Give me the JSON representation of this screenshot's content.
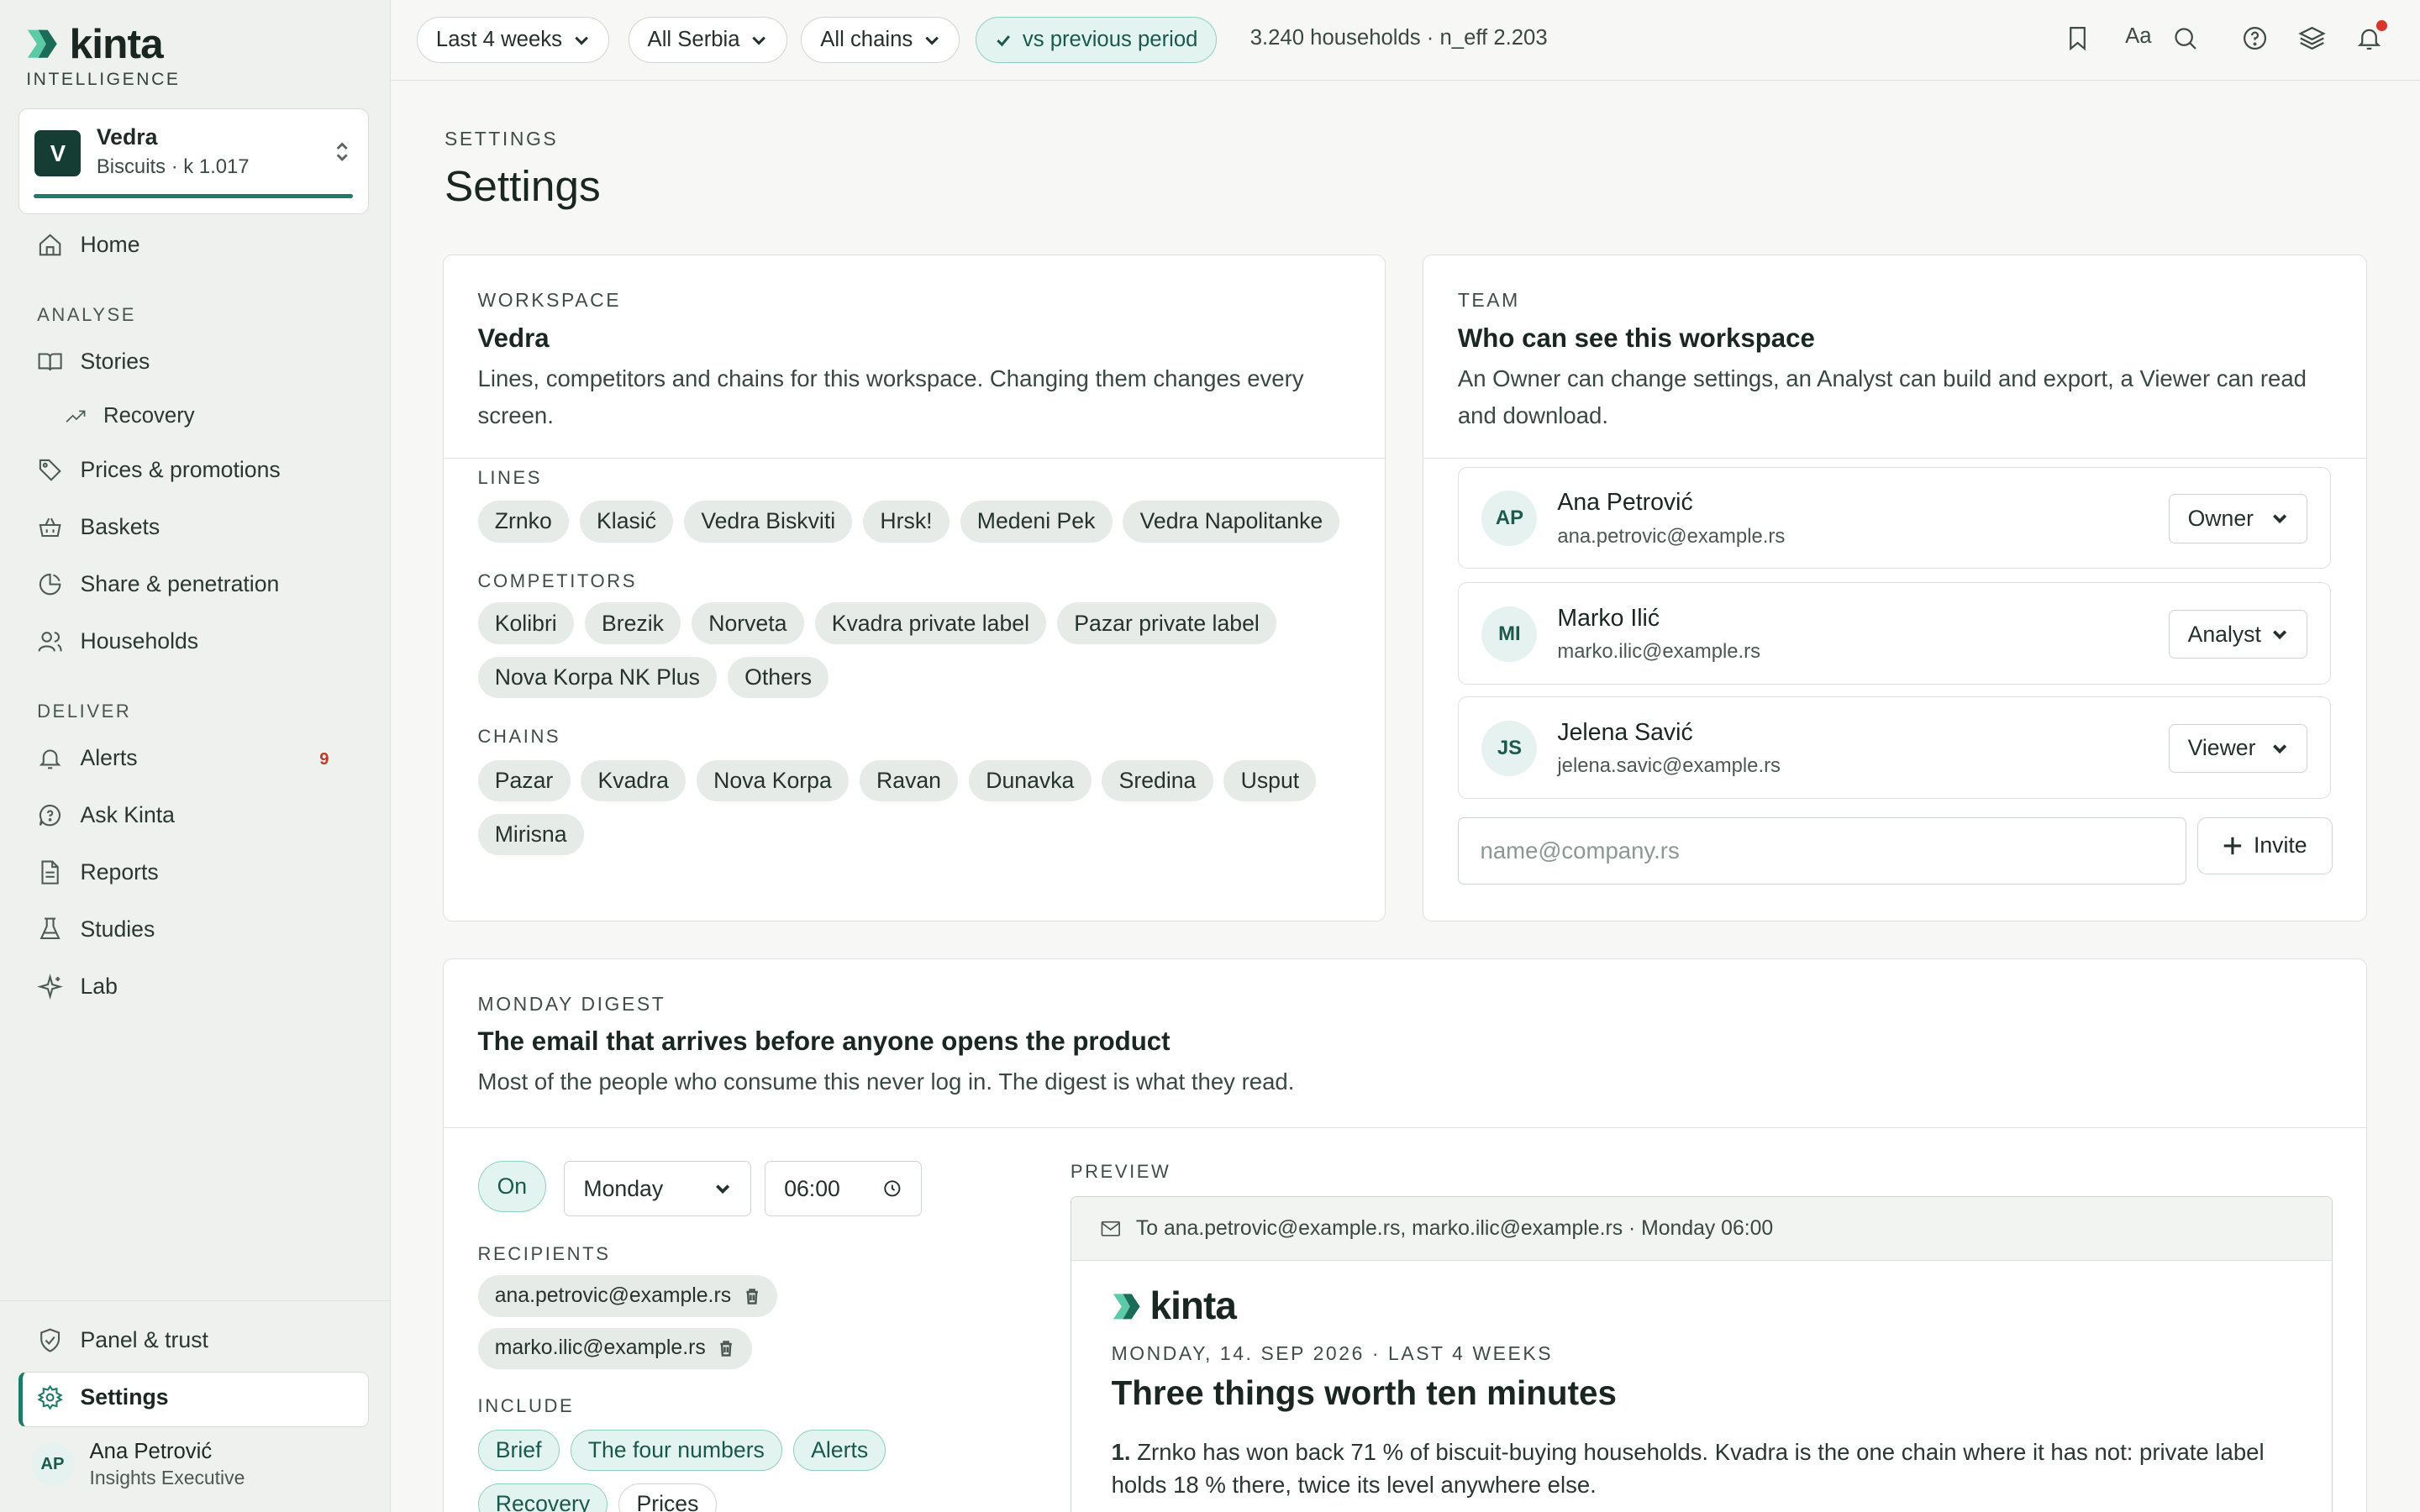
{
  "brand": {
    "name": "kinta",
    "sub": "INTELLIGENCE"
  },
  "workspace_switcher": {
    "initial": "V",
    "name": "Vedra",
    "meta": "Biscuits · k 1.017"
  },
  "nav": {
    "home": "Home",
    "analyse_section": "ANALYSE",
    "stories": "Stories",
    "recovery": "Recovery",
    "prices": "Prices & promotions",
    "baskets": "Baskets",
    "share": "Share & penetration",
    "households": "Households",
    "deliver_section": "DELIVER",
    "alerts": "Alerts",
    "alerts_badge": "9",
    "ask": "Ask Kinta",
    "reports": "Reports",
    "studies": "Studies",
    "lab": "Lab",
    "panel": "Panel & trust",
    "settings": "Settings"
  },
  "user": {
    "initials": "AP",
    "name": "Ana Petrović",
    "role": "Insights Executive"
  },
  "topbar": {
    "period": "Last 4 weeks",
    "region": "All Serbia",
    "chains": "All chains",
    "compare": "vs previous period",
    "households_info": "3.240 households · n_eff 2.203",
    "font_toggle": "Aa"
  },
  "page": {
    "crumb": "SETTINGS",
    "title": "Settings"
  },
  "workspace_card": {
    "kicker": "WORKSPACE",
    "title": "Vedra",
    "desc": "Lines, competitors and chains for this workspace. Changing them changes every screen.",
    "lines_label": "LINES",
    "lines": [
      "Zrnko",
      "Klasić",
      "Vedra Biskviti",
      "Hrsk!",
      "Medeni Pek",
      "Vedra Napolitanke"
    ],
    "competitors_label": "COMPETITORS",
    "competitors": [
      "Kolibri",
      "Brezik",
      "Norveta",
      "Kvadra private label",
      "Pazar private label",
      "Nova Korpa NK Plus",
      "Others"
    ],
    "chains_label": "CHAINS",
    "chains": [
      "Pazar",
      "Kvadra",
      "Nova Korpa",
      "Ravan",
      "Dunavka",
      "Sredina",
      "Usput",
      "Mirisna"
    ]
  },
  "team_card": {
    "kicker": "TEAM",
    "title": "Who can see this workspace",
    "desc": "An Owner can change settings, an Analyst can build and export, a Viewer can read and download.",
    "members": [
      {
        "initials": "AP",
        "name": "Ana Petrović",
        "email": "ana.petrovic@example.rs",
        "role": "Owner"
      },
      {
        "initials": "MI",
        "name": "Marko Ilić",
        "email": "marko.ilic@example.rs",
        "role": "Analyst"
      },
      {
        "initials": "JS",
        "name": "Jelena Savić",
        "email": "jelena.savic@example.rs",
        "role": "Viewer"
      }
    ],
    "invite_placeholder": "name@company.rs",
    "invite_label": "Invite"
  },
  "digest_card": {
    "kicker": "MONDAY DIGEST",
    "title": "The email that arrives before anyone opens the product",
    "desc": "Most of the people who consume this never log in. The digest is what they read.",
    "status": "On",
    "day": "Monday",
    "time": "06:00",
    "recipients_label": "RECIPIENTS",
    "recipients": [
      "ana.petrovic@example.rs",
      "marko.ilic@example.rs"
    ],
    "include_label": "INCLUDE",
    "include": [
      {
        "label": "Brief",
        "on": true
      },
      {
        "label": "The four numbers",
        "on": true
      },
      {
        "label": "Alerts",
        "on": true
      },
      {
        "label": "Recovery",
        "on": true
      },
      {
        "label": "Prices",
        "on": false
      }
    ],
    "preview_label": "PREVIEW",
    "preview": {
      "to_line": "To ana.petrovic@example.rs, marko.ilic@example.rs · Monday 06:00",
      "date_line": "MONDAY, 14. SEP 2026 · LAST 4 WEEKS",
      "headline": "Three things worth ten minutes",
      "item_number": "1.",
      "item_text": "Zrnko has won back 71 % of biscuit-buying households. Kvadra is the one chain where it has not: private label holds 18 % there, twice its level anywhere else."
    }
  },
  "colors": {
    "accent": "#1f7a6a",
    "accent_soft": "#e3f4f0",
    "alert": "#c03a2b",
    "brand_green": "#1fa27b"
  }
}
